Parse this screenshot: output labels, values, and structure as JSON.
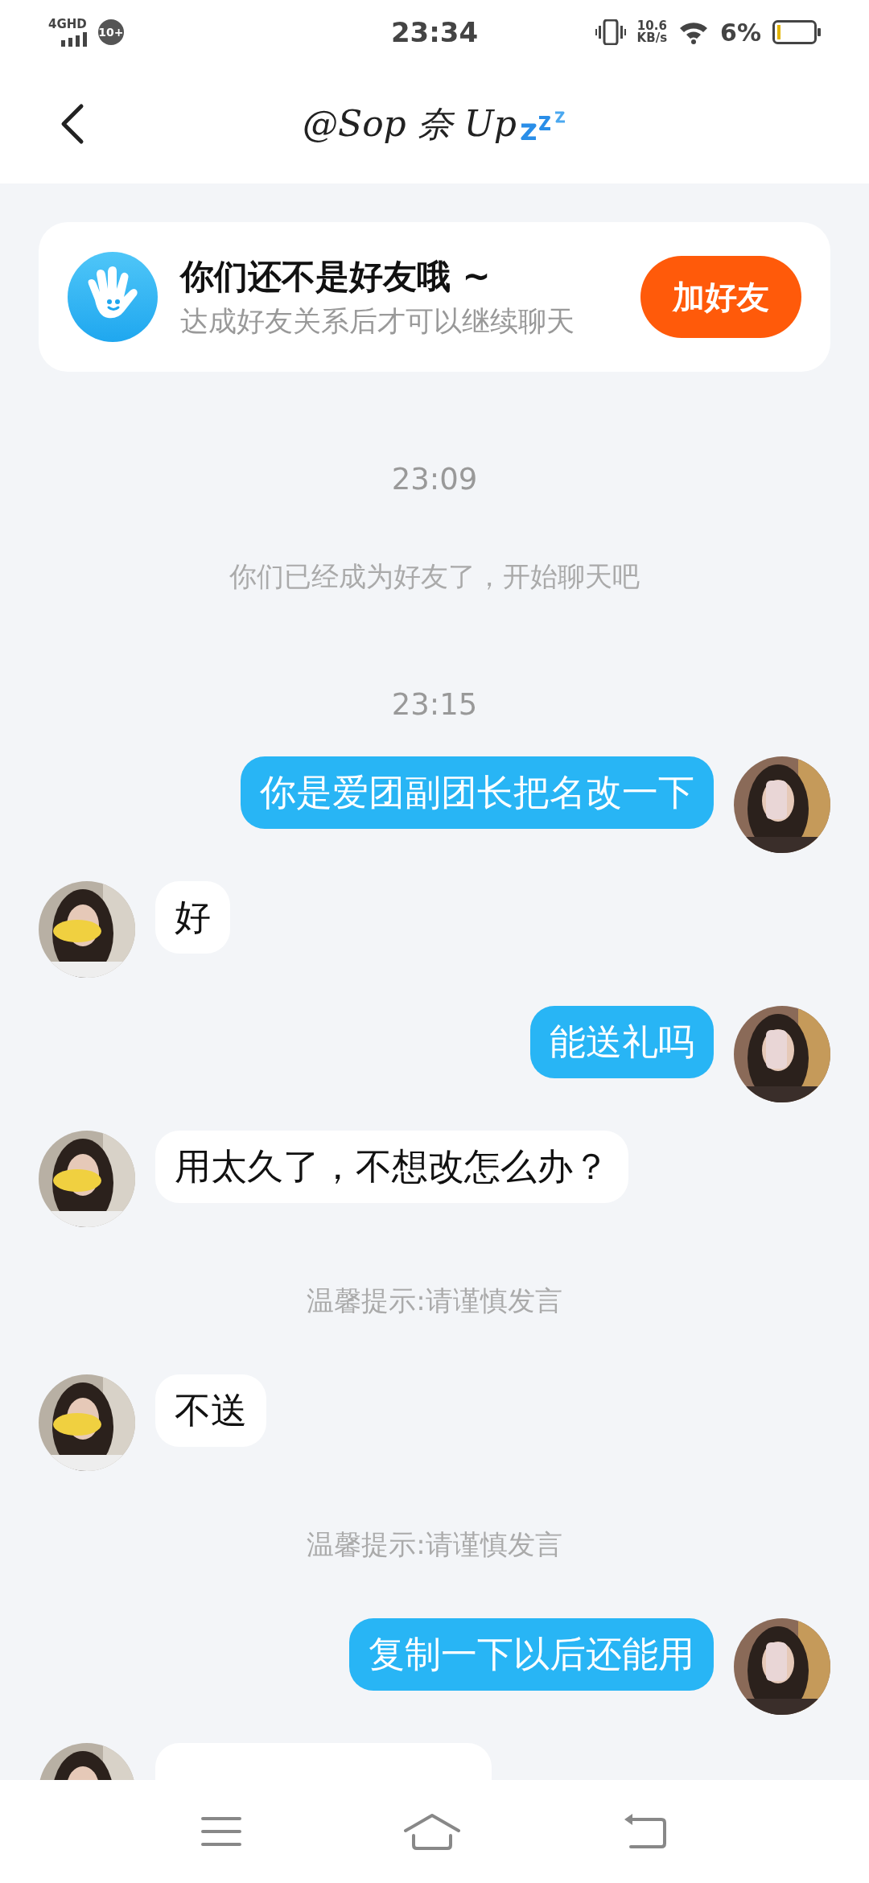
{
  "status_bar": {
    "network": "4GHD",
    "notification_count": "10+",
    "time": "23:34",
    "speed_value": "10.6",
    "speed_unit": "KB/s",
    "battery": "6%"
  },
  "header": {
    "title": "@Sop 奈 Up"
  },
  "friend_notice": {
    "title": "你们还不是好友哦 ~",
    "subtitle": "达成好友关系后才可以继续聊天",
    "button": "加好友"
  },
  "messages": [
    {
      "kind": "time",
      "text": "23:09"
    },
    {
      "kind": "system",
      "text": "你们已经成为好友了，开始聊天吧"
    },
    {
      "kind": "time",
      "text": "23:15"
    },
    {
      "kind": "outgoing",
      "text": "你是爱团副团长把名改一下"
    },
    {
      "kind": "incoming",
      "text": "好"
    },
    {
      "kind": "outgoing",
      "text": "能送礼吗"
    },
    {
      "kind": "incoming",
      "text": "用太久了，不想改怎么办？"
    },
    {
      "kind": "system",
      "text": "温馨提示:请谨慎发言"
    },
    {
      "kind": "incoming",
      "text": "不送"
    },
    {
      "kind": "system",
      "text": "温馨提示:请谨慎发言"
    },
    {
      "kind": "outgoing",
      "text": "复制一下以后还能用"
    },
    {
      "kind": "incoming"
    }
  ]
}
